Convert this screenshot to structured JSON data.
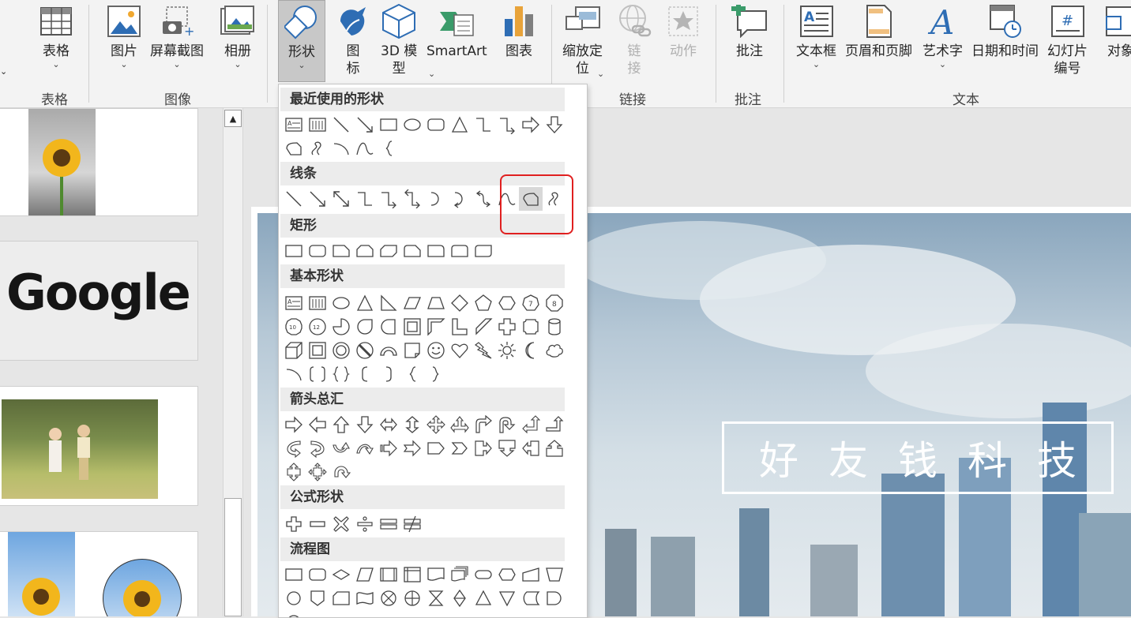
{
  "ribbon": {
    "buttons": [
      {
        "label": "表格",
        "icon": "table-icon",
        "caret": "⌄"
      },
      {
        "label": "图片",
        "icon": "picture-icon",
        "caret": "⌄"
      },
      {
        "label": "屏幕截图",
        "icon": "screenshot-icon",
        "caret": "⌄"
      },
      {
        "label": "相册",
        "icon": "photo-album-icon",
        "caret": "⌄"
      },
      {
        "label": "形状",
        "icon": "shapes-icon",
        "caret": "⌄"
      },
      {
        "label": "图\n标",
        "icon": "icons-icon"
      },
      {
        "label": "3D 模\n型",
        "icon": "3d-model-icon",
        "caret": "⌄"
      },
      {
        "label": "SmartArt",
        "icon": "smartart-icon"
      },
      {
        "label": "图表",
        "icon": "chart-icon"
      },
      {
        "label": "缩放定\n位",
        "icon": "zoom-icon",
        "caret": "⌄"
      },
      {
        "label": "链\n接",
        "icon": "link-icon"
      },
      {
        "label": "动作",
        "icon": "action-icon"
      },
      {
        "label": "批注",
        "icon": "comment-icon"
      },
      {
        "label": "文本框",
        "icon": "textbox-icon",
        "caret": "⌄"
      },
      {
        "label": "页眉和页脚",
        "icon": "header-footer-icon"
      },
      {
        "label": "艺术字",
        "icon": "wordart-icon",
        "caret": "⌄"
      },
      {
        "label": "日期和时间",
        "icon": "date-time-icon"
      },
      {
        "label": "幻灯片\n编号",
        "icon": "slide-number-icon"
      },
      {
        "label": "对象",
        "icon": "object-icon"
      }
    ],
    "groups": {
      "table": "表格",
      "image": "图像",
      "links": "链接",
      "comments": "批注",
      "text": "文本"
    }
  },
  "shapes_menu": {
    "sections": {
      "recent": "最近使用的形状",
      "lines": "线条",
      "rectangles": "矩形",
      "basic": "基本形状",
      "arrows": "箭头总汇",
      "equation": "公式形状",
      "flowchart": "流程图"
    },
    "basic_labels": {
      "heptagon": "7",
      "octagon": "8",
      "decagon": "10",
      "dodecagon": "12"
    }
  },
  "slide": {
    "title": "好友钱科技"
  },
  "thumbnails": {
    "google_text": "Google"
  },
  "colors": {
    "ribbon_bg": "#f3f3f3",
    "highlight_box": "#e02020",
    "slide_title": "#ffffff"
  }
}
